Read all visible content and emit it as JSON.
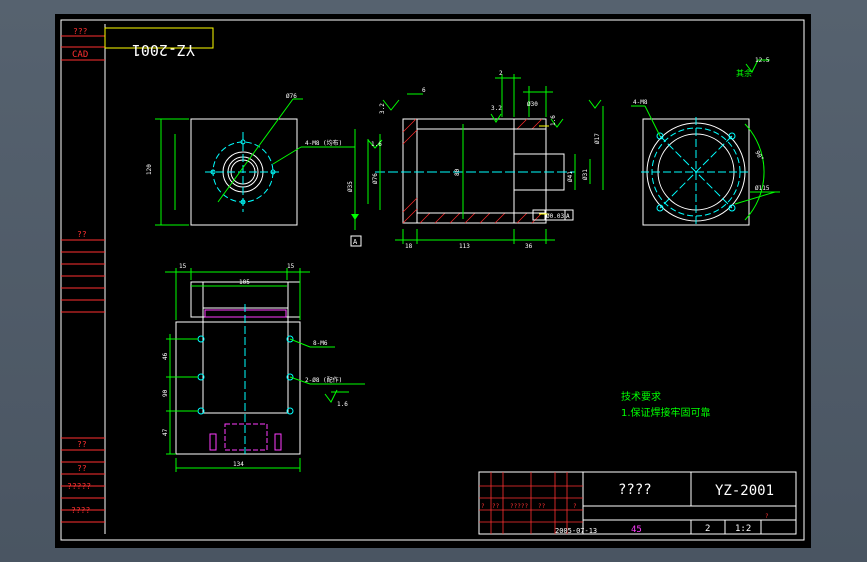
{
  "drawing": {
    "code_box_mirrored": "YZ-2001",
    "left_strip": {
      "top_mark": "???",
      "cad": "CAD",
      "mid_mark": "??",
      "lower_marks": [
        "??",
        "??",
        "?????",
        "????"
      ]
    },
    "top_view": {
      "dim_left": "120",
      "dim_bore": "Ø76",
      "label_holes": "4-M8 (均布)"
    },
    "section_view": {
      "dim_top_small": "2",
      "dim_3_2": "3.2",
      "dim_6": "6",
      "dim_1_6_a": "1.6",
      "dim_3_2_b": "3.2",
      "dim_1_6_top": "1.6",
      "dim_h": "80",
      "dim_phi30": "Ø30",
      "dim_phi17": "Ø17",
      "dim_phi76": "Ø76",
      "dim_phi35": "Ø35",
      "dim_phi41": "Ø41",
      "dim_phi31": "Ø31",
      "dim_bottom_left": "18",
      "dim_bottom_mid": "113",
      "dim_bottom_right": "36",
      "tol_box": "Ø0.03",
      "tol_ref": "A",
      "datum": "A"
    },
    "end_view": {
      "label_holes": "4-M8",
      "dim_angle": "90°",
      "dim_pcd": "Ø115"
    },
    "roughness_note": "其余",
    "roughness_value": "12.5",
    "bottom_view": {
      "dim_top_l": "15",
      "dim_top_r": "15",
      "dim_inner": "105",
      "dim_side_1": "46",
      "dim_side_2": "90",
      "dim_side_3": "47",
      "dim_bottom": "134",
      "label_m6": "8-M6",
      "label_pins": "2-Ø8 (配作)",
      "roughness": "1.6"
    },
    "notes": {
      "heading": "技术要求",
      "item1": "1.保证焊接牢固可靠"
    },
    "title_block": {
      "name": "????",
      "code": "YZ-2001",
      "qty": "45",
      "sheet": "2",
      "scale": "1:2",
      "date": "2005-07-13",
      "small_marks": [
        "?",
        "??",
        "?????",
        "??",
        "?",
        "?"
      ]
    }
  },
  "colors": {
    "frame": "#ffffff",
    "outline": "#ffffff",
    "dimension": "#00ff00",
    "center": "#00ffff",
    "hatch": "#ff2a2a",
    "yellow": "#ffff00",
    "magenta": "#ff3cff",
    "red_text": "#ff3030"
  }
}
